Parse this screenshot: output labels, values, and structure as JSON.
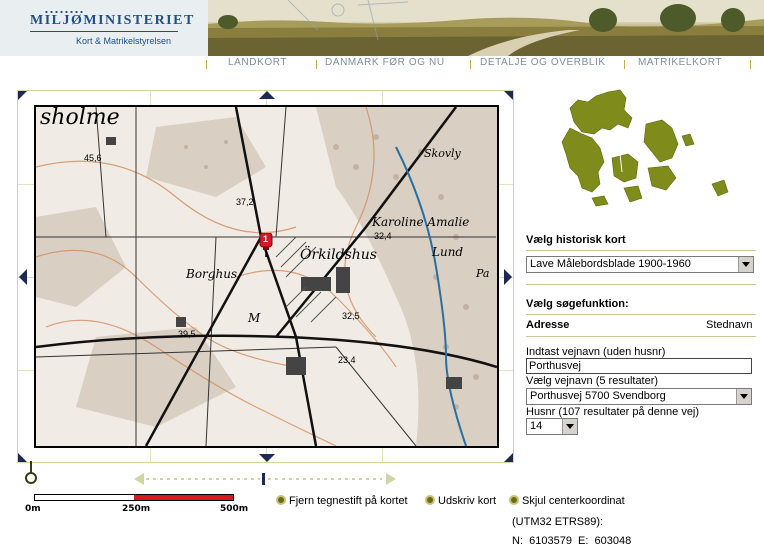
{
  "header": {
    "ministry": "MILJØMINISTERIET",
    "agency": "Kort & Matrikelstyrelsen"
  },
  "nav": {
    "items": [
      {
        "label": "LANDKORT"
      },
      {
        "label": "DANMARK FØR OG NU"
      },
      {
        "label": "DETALJE OG OVERBLIK"
      },
      {
        "label": "MATRIKELKORT"
      }
    ]
  },
  "map": {
    "labels": {
      "sholme": "sholme",
      "skovly": "Skovly",
      "karoline": "Karoline Amalie",
      "lund": "Lund",
      "orkildshus": "Örkildshus",
      "borghus": "Borghus",
      "pa": "Pa",
      "elev_1": "45,6",
      "elev_2": "37,2",
      "elev_3": "32,4",
      "elev_4": "39,5",
      "elev_5": "32,5",
      "elev_6": "23,4",
      "m": "M"
    },
    "marker_label": "1"
  },
  "scale": {
    "labels": [
      "0m",
      "250m",
      "500m"
    ]
  },
  "options": {
    "remove_pin": "Fjern tegnestift på kortet",
    "print": "Udskriv kort",
    "hide_coords": "Skjul centerkoordinat",
    "coord_system": "(UTM32 ETRS89):",
    "coord_values": "N:  6103579  E:  603048"
  },
  "panel": {
    "historic_map_title": "Vælg historisk kort",
    "historic_map_value": "Lave Målebordsblade 1900-1960",
    "search_title": "Vælg søgefunktion:",
    "search_mode_address": "Adresse",
    "search_mode_place": "Stednavn",
    "street_label": "Indtast vejnavn (uden husnr)",
    "street_value": "Porthusvej",
    "street_select_label": "Vælg vejnavn (5 resultater)",
    "street_select_value": "Porthusvej 5700 Svendborg",
    "house_label": "Husnr (107 resultater på denne vej)",
    "house_value": "14"
  },
  "colors": {
    "nav_text": "#7d8ea6",
    "brand_blue": "#1f4f86",
    "frame_arrow": "#1c2a55",
    "denmark_green": "#7f8b1a",
    "scale_red": "#d61a1a",
    "marker_red": "#d21a2a"
  },
  "icons": {
    "pan": "arrow-icon",
    "marker": "map-pin-icon",
    "radio": "radio-icon"
  }
}
